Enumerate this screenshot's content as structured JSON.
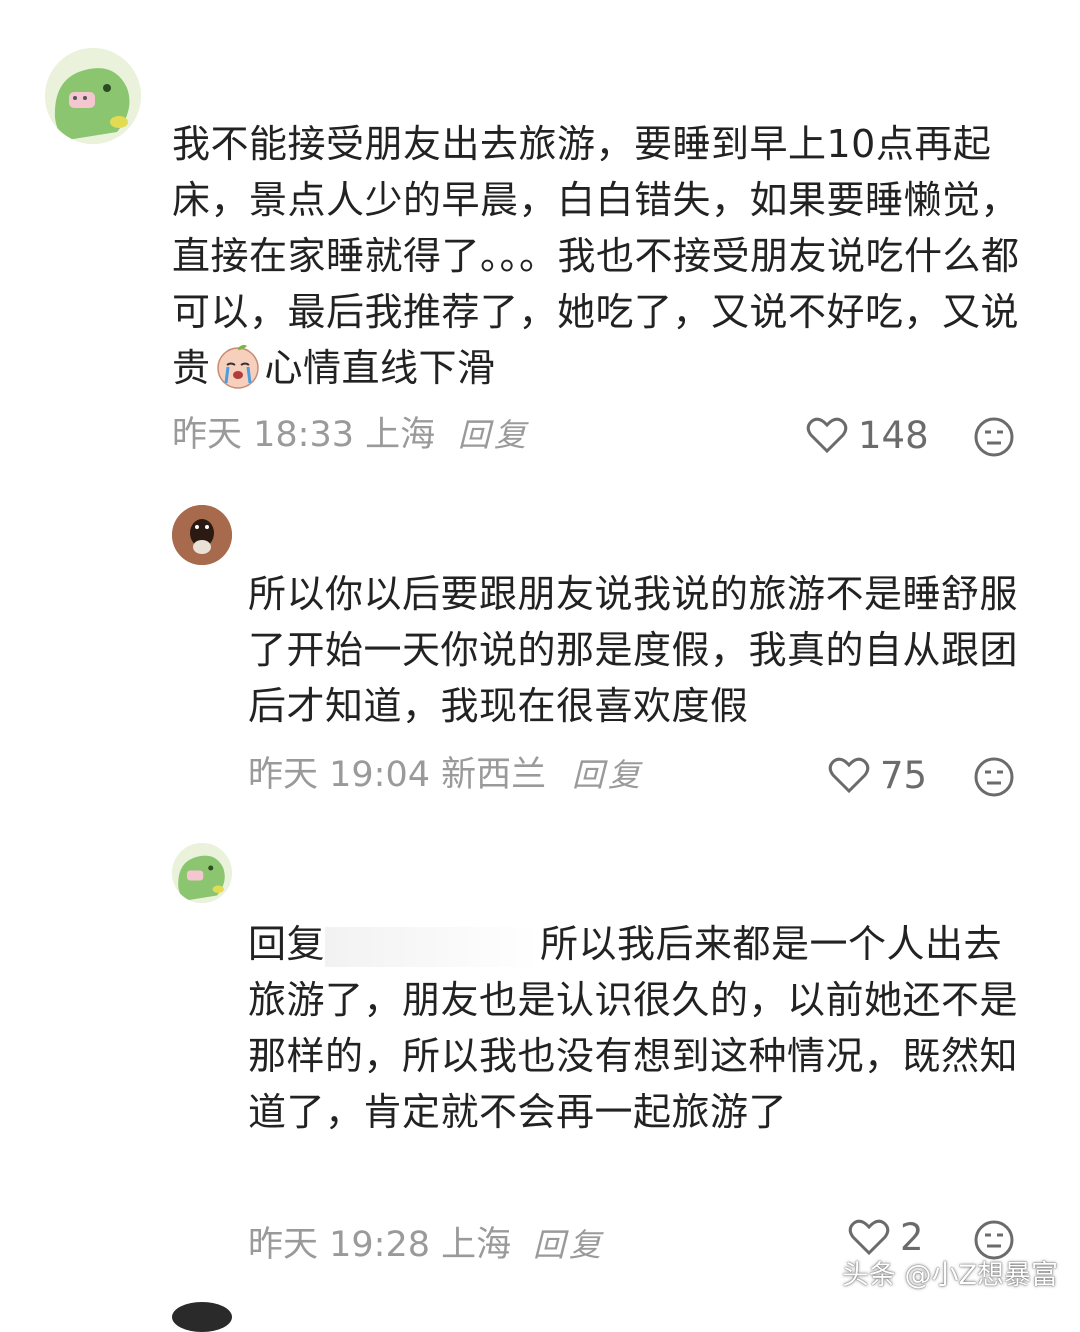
{
  "comments": [
    {
      "text_before": "我不能接受朋友出去旅游，要睡到早上10点再起床，景点人少的早晨，白白错失，如果要睡懒觉，直接在家睡就得了。。。我也不接受朋友说吃什么都可以，最后我推荐了，她吃了，又说不好吃，又说贵",
      "emoji": "crying-peach-emoji",
      "text_after": "心情直线下滑",
      "time_location": "昨天 18:33 上海",
      "reply_label": "回复",
      "likes": "148"
    },
    {
      "text": "所以你以后要跟朋友说我说的旅游不是睡舒服了开始一天你说的那是度假，我真的自从跟团后才知道，我现在很喜欢度假",
      "time_location": "昨天 19:04 新西兰",
      "reply_label": "回复",
      "likes": "75"
    },
    {
      "reply_prefix": "回复",
      "text": "所以我后来都是一个人出去旅游了，朋友也是认识很久的，以前她还不是那样的，所以我也没有想到这种情况，既然知道了，肯定就不会再一起旅游了",
      "time_location": "昨天 19:28 上海",
      "reply_label": "回复",
      "likes": "2"
    }
  ],
  "icons": {
    "like": "heart-outline-icon",
    "more": "neutral-face-icon"
  },
  "watermark": "头条 @小Z想暴富",
  "colors": {
    "text": "#222222",
    "meta": "#9a9a9a",
    "background": "#ffffff"
  }
}
